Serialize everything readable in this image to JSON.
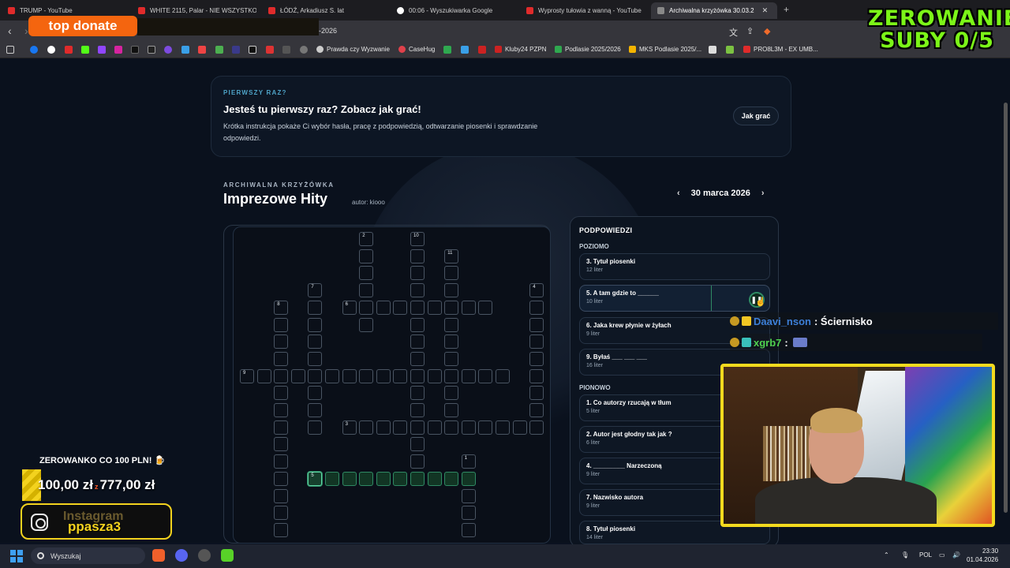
{
  "browser": {
    "tabs": [
      {
        "title": "TRUMP - YouTube"
      },
      {
        "title": "WHITE 2115, Palar - NIE WSZYSTKO"
      },
      {
        "title": "ŁÓDŹ, Arkadiusz S. lat"
      },
      {
        "title": "00:06 - Wyszukiwarka Google"
      },
      {
        "title": "Wyprosty tułowia z wanną - YouTube"
      },
      {
        "title": "Archiwalna krzyżówka 30.03.2"
      }
    ],
    "url_tail": "-2026",
    "bookmarks": [
      "Prawda czy Wyzwanie",
      "CaseHug",
      "Kluby24 PZPN",
      "Podlasie 2025/2026",
      "MKS Podlasie 2025/...",
      "PRO8L3M - EX UMB..."
    ]
  },
  "intro": {
    "kicker": "PIERWSZY RAZ?",
    "title": "Jesteś tu pierwszy raz? Zobacz jak grać!",
    "desc": "Krótka instrukcja pokaże Ci wybór hasła, pracę z podpowiedzią, odtwarzanie piosenki i sprawdzanie odpowiedzi.",
    "button": "Jak grać"
  },
  "puzzle": {
    "kicker": "ARCHIWALNA KRZYŻÓWKA",
    "title": "Imprezowe Hity",
    "author": "autor: kiooo",
    "date": "30 marca 2026",
    "prev": "‹",
    "next": "›"
  },
  "clues": {
    "title": "PODPOWIEDZI",
    "across_label": "POZIOMO",
    "down_label": "PIONOWO",
    "across": [
      {
        "text": "3. Tytuł piosenki",
        "len": "12 liter"
      },
      {
        "text": "5. A tam gdzie to ______",
        "len": "10 liter"
      },
      {
        "text": "6. Jaka krew płynie w żyłach",
        "len": "9 liter"
      },
      {
        "text": "9. Byłaś ___ ___ ___",
        "len": "16 liter"
      }
    ],
    "down": [
      {
        "text": "1. Co autorzy rzucają w tłum",
        "len": "5 liter"
      },
      {
        "text": "2. Autor jest głodny tak jak ?",
        "len": "6 liter"
      },
      {
        "text": "4. _________ Narzeczoną",
        "len": "9 liter"
      },
      {
        "text": "7. Nazwisko autora",
        "len": "9 liter"
      },
      {
        "text": "8. Tytuł piosenki",
        "len": "14 liter"
      }
    ],
    "play_icon": "pause-icon"
  },
  "overlay": {
    "top_donate": "top donate",
    "zerowanie_l1": "ZEROWANIE",
    "zerowanie_l2": "SUBY 0/5",
    "chat": [
      {
        "user": "Daavi_nson",
        "msg": ": Ściernisko",
        "color": "#3d7fd6"
      },
      {
        "user": "xgrb7",
        "msg": ":",
        "color": "#4fd14f"
      }
    ],
    "goal_label": "ZEROWANKO CO 100 PLN! 🍺",
    "goal_current": "100,00 zł",
    "goal_sep": "z",
    "goal_target": "777,00 zł",
    "insta_label": "Instagram",
    "insta_handle": "ppasza3"
  },
  "taskbar": {
    "search_placeholder": "Wyszukaj",
    "lang": "POL",
    "time": "23:30",
    "date": "01.04.2026"
  }
}
